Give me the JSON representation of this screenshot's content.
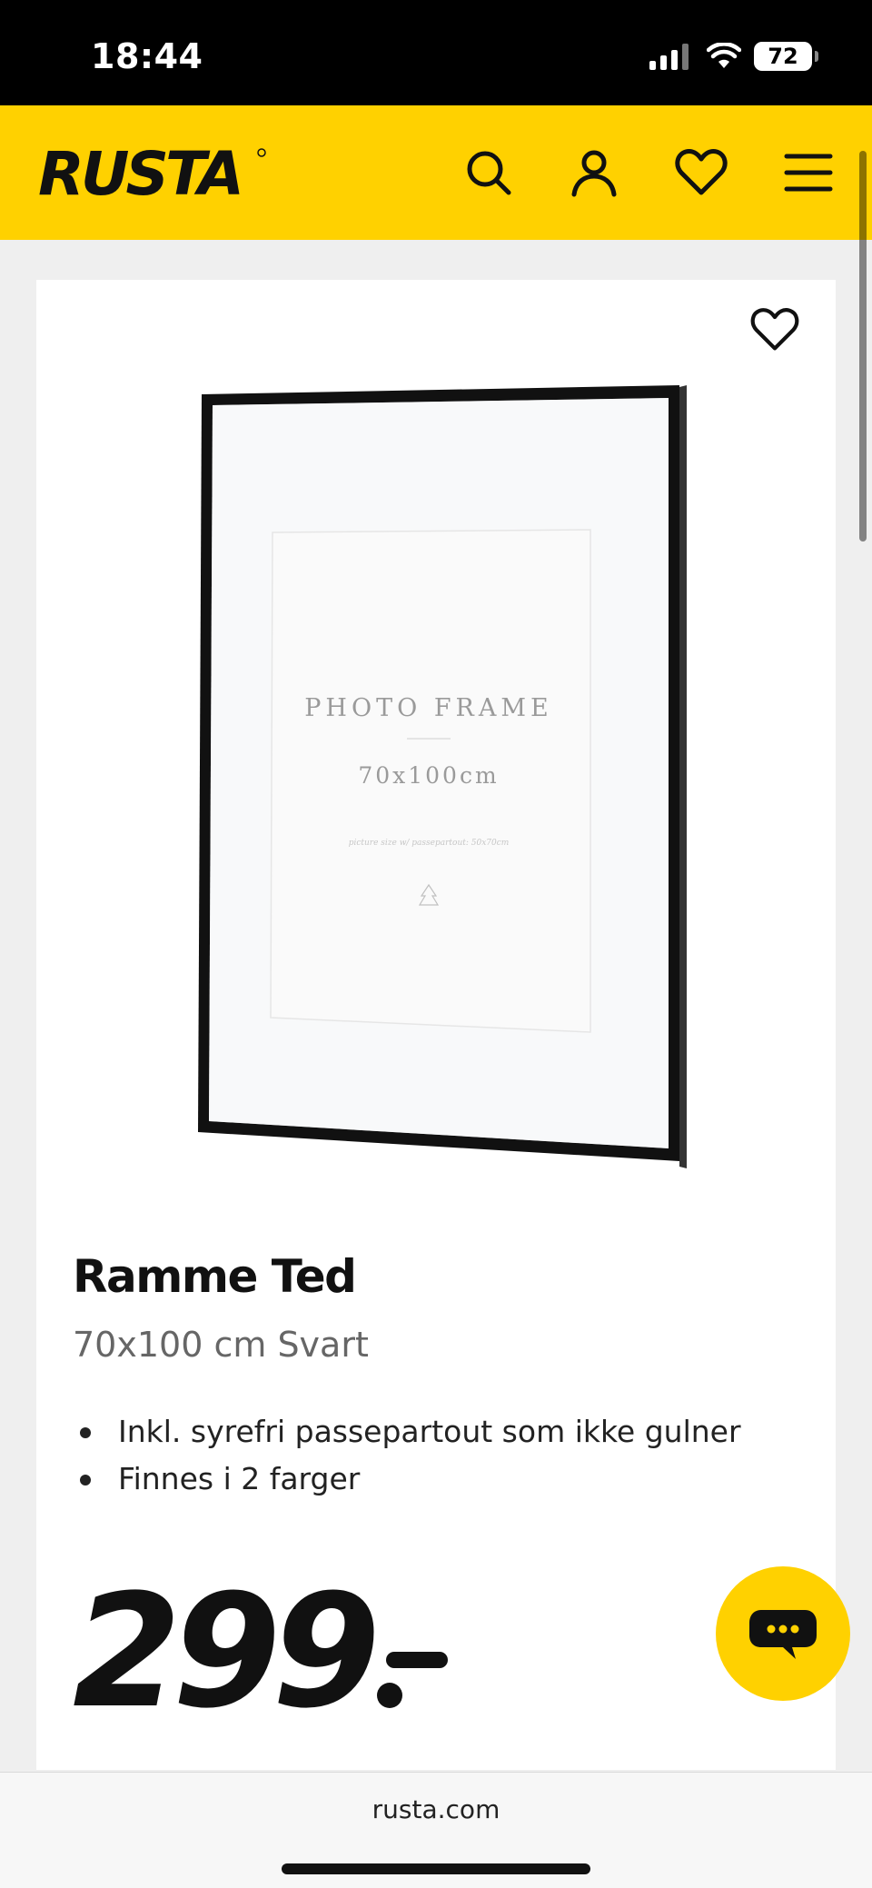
{
  "status_bar": {
    "time": "18:44",
    "battery": "72",
    "icons": [
      "cellular-signal-icon",
      "wifi-icon",
      "battery-icon"
    ]
  },
  "header": {
    "logo_text": "RUSTA",
    "background_color": "#ffd100",
    "icons": [
      "search-icon",
      "account-icon",
      "wishlist-heart-icon",
      "menu-hamburger-icon"
    ]
  },
  "product": {
    "image": {
      "title": "PHOTO FRAME",
      "size": "70x100cm",
      "small_text": "picture size w/ passepartout: 50x70cm"
    },
    "title": "Ramme Ted",
    "subtitle": "70x100 cm Svart",
    "features": [
      "Inkl. syrefri passepartout som ikke gulner",
      "Finnes i 2 farger"
    ],
    "price": "299"
  },
  "chat": {
    "icon": "chat-bubble-icon",
    "accent_color": "#ffd100"
  },
  "browser": {
    "url": "rusta.com"
  }
}
